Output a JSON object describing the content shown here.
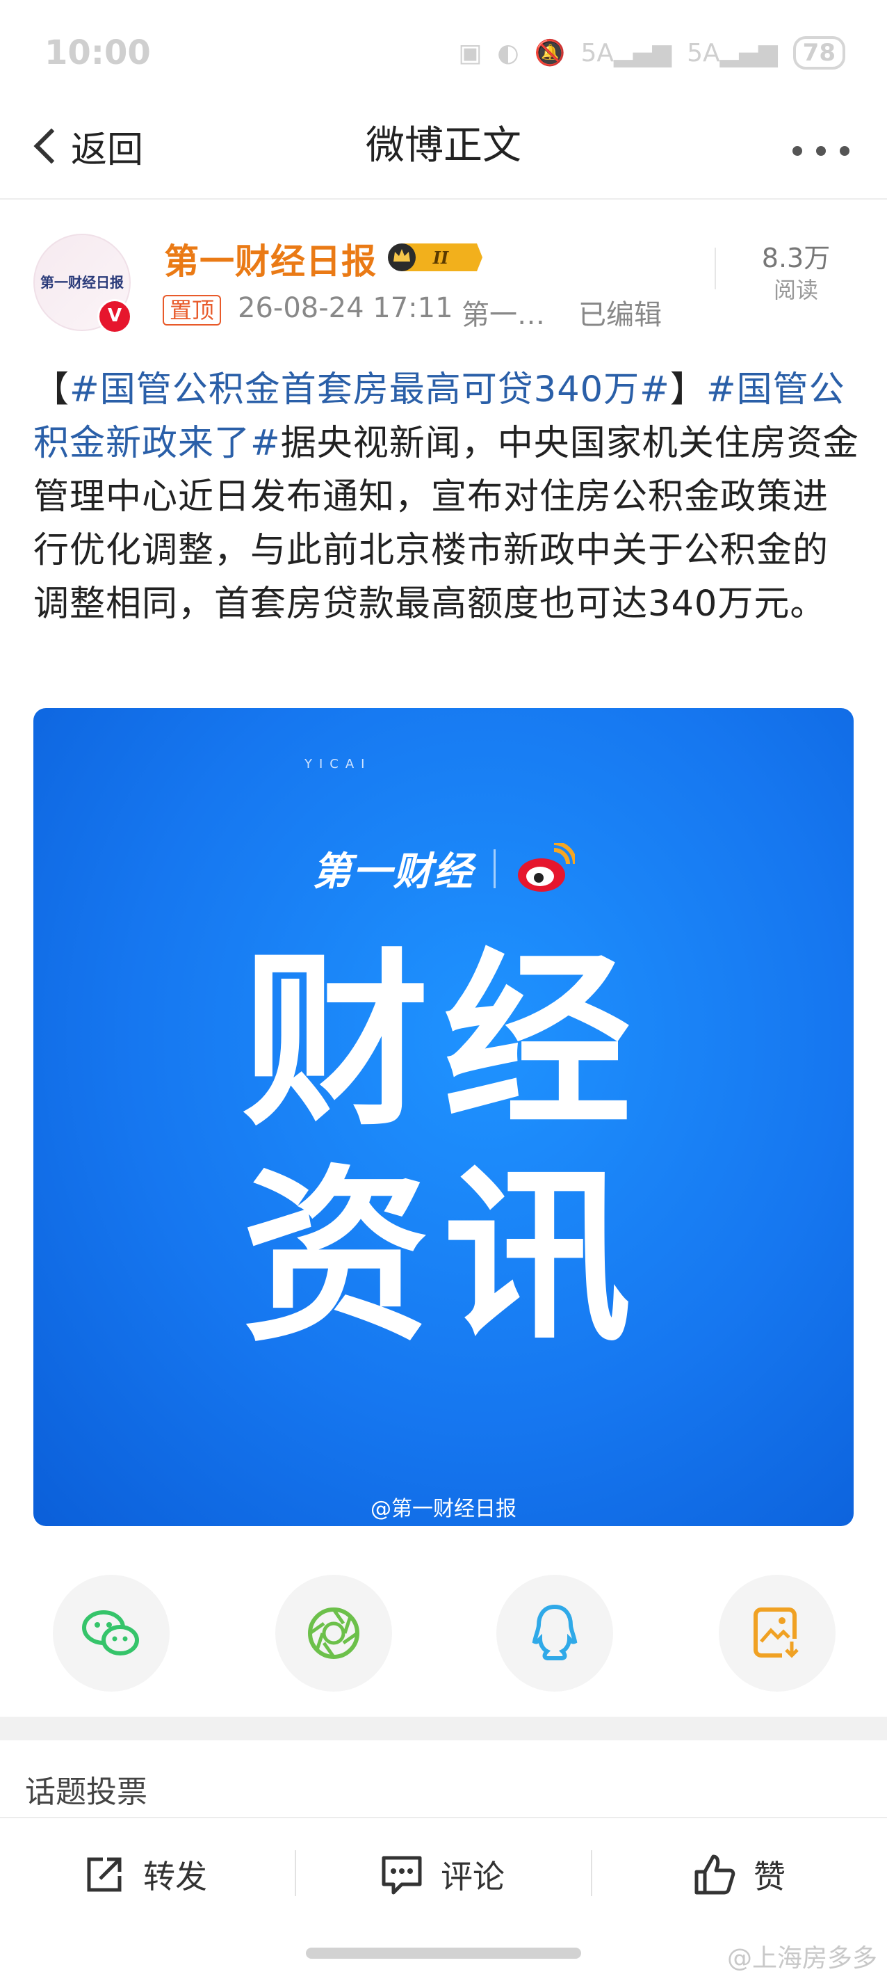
{
  "status_bar": {
    "time": "10:00",
    "signal1": "5A",
    "signal2": "5A",
    "battery": "78"
  },
  "nav": {
    "back_label": "返回",
    "title": "微博正文"
  },
  "author": {
    "name": "第一财经日报",
    "avatar_text": "第一财经日报",
    "verified": "V",
    "level_badge": "II",
    "pin_label": "置顶",
    "time": "26-08-24 17:11",
    "source": "第一…",
    "edited": "已编辑",
    "read_count": "8.3万",
    "read_label": "阅读"
  },
  "post": {
    "lead": "【",
    "topic1": "#国管公积金首套房最高可贷340万#",
    "close": "】",
    "topic2": "#国管公积金新政来了#",
    "text": "据央视新闻，中央国家机关住房资金管理中心近日发布通知，宣布对住房公积金政策进行优化调整，与此前北京楼市新政中关于公积金的调整相同，首套房贷款最高额度也可达340万元。"
  },
  "image": {
    "brand": "第一财经",
    "brand_sub": "YICAI",
    "big_line1": "财经",
    "big_line2": "资讯",
    "watermark": "@第一财经日报"
  },
  "share": [
    "wechat",
    "moments",
    "qq",
    "save-image"
  ],
  "section": {
    "label": "话题投票"
  },
  "actions": {
    "repost": "转发",
    "comment": "评论",
    "like": "赞"
  },
  "corner_watermark": "@上海房多多",
  "colors": {
    "accent_orange": "#ea7a15",
    "topic_blue": "#2a5fa8",
    "image_blue": "#1677f0"
  }
}
